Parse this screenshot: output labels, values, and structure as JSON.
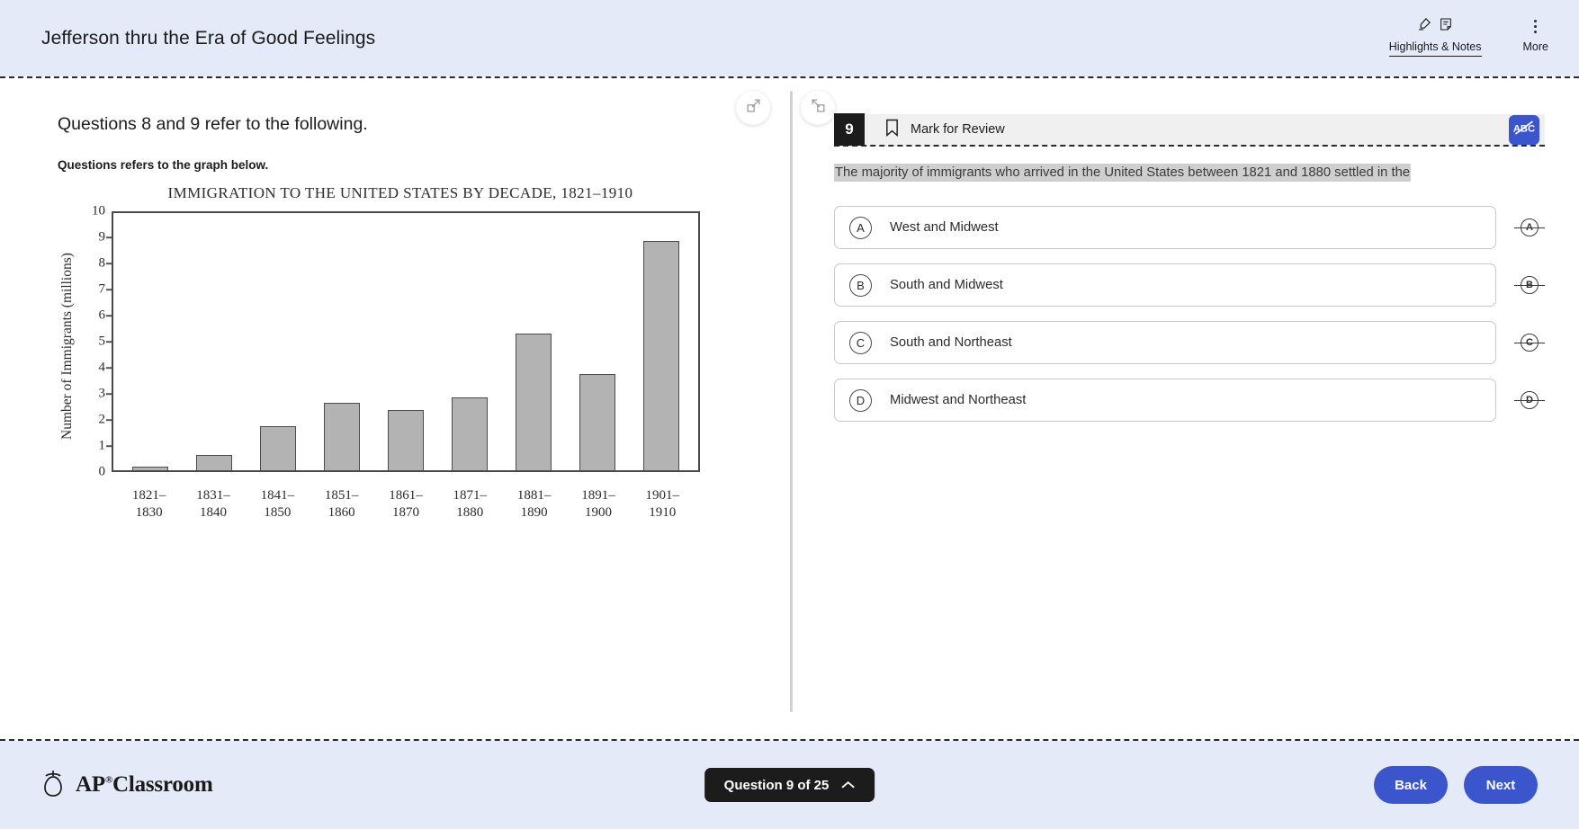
{
  "header": {
    "title": "Jefferson thru the Era of Good Feelings",
    "highlights_label": "Highlights & Notes",
    "more_label": "More"
  },
  "stimulus": {
    "instruction": "Questions 8 and 9 refer to the following.",
    "subinstruction": "Questions refers to the graph below."
  },
  "chart_data": {
    "type": "bar",
    "title": "IMMIGRATION TO THE UNITED STATES BY DECADE, 1821–1910",
    "xlabel": "",
    "ylabel": "Number of Immigrants (millions)",
    "ylim": [
      0,
      10
    ],
    "yticks": [
      0,
      1,
      2,
      3,
      4,
      5,
      6,
      7,
      8,
      9,
      10
    ],
    "grid": false,
    "legend": false,
    "categories": [
      "1821–1830",
      "1831–1840",
      "1841–1850",
      "1851–1860",
      "1861–1870",
      "1871–1880",
      "1881–1890",
      "1891–1900",
      "1901–1910"
    ],
    "values": [
      0.14,
      0.6,
      1.7,
      2.6,
      2.3,
      2.8,
      5.25,
      3.7,
      8.8
    ],
    "bar_fill": "#b3b3b3",
    "bar_stroke": "#4b4b4b"
  },
  "question": {
    "number": "9",
    "mark_for_review": "Mark for Review",
    "stem": "The majority of immigrants who arrived in the United States between 1821 and 1880 settled in the",
    "choices": [
      {
        "letter": "A",
        "text": "West and Midwest"
      },
      {
        "letter": "B",
        "text": "South and Midwest"
      },
      {
        "letter": "C",
        "text": "South and Northeast"
      },
      {
        "letter": "D",
        "text": "Midwest and Northeast"
      }
    ]
  },
  "footer": {
    "brand": "AP",
    "brand_suffix": "Classroom",
    "question_pill": "Question 9 of 25",
    "back_label": "Back",
    "next_label": "Next"
  },
  "colors": {
    "chrome_bg": "#e4eaf7",
    "accent_blue": "#3b55cc",
    "badge_black": "#1c1c1c",
    "highlight_gray": "#cfcfcf"
  }
}
